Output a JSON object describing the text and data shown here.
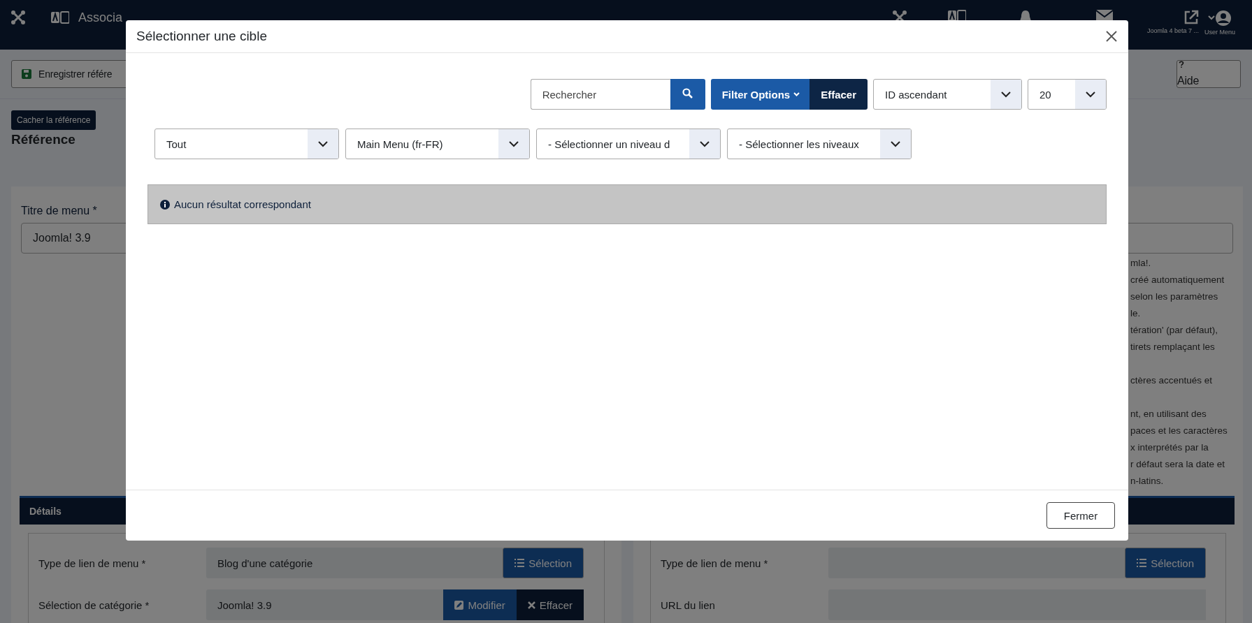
{
  "header": {
    "title": "Associa",
    "items": [
      {
        "kind": "logo"
      },
      {
        "kind": "translate"
      },
      {
        "kind": "bell"
      },
      {
        "kind": "mail"
      },
      {
        "kind": "external",
        "label": "Joomla 4 beta 7 ..."
      },
      {
        "kind": "user",
        "label": "User Menu"
      }
    ]
  },
  "toolbar": {
    "buttons": [
      {
        "kind": "save",
        "label": "Enregistrer référe"
      },
      {
        "kind": "help",
        "label": "Aide"
      }
    ]
  },
  "reference": {
    "toggle": "Cacher la référence",
    "heading": "Référence"
  },
  "left_card": {
    "label": "Titre de menu *",
    "value": "Joomla! 3.9"
  },
  "right_card": {
    "help_lines": [
      "mla!.",
      "créé automatiquement",
      "selon les paramètres",
      "le.",
      "tération' (par défaut),",
      "tirets remplaçant les",
      "ctères accentués et",
      "nt, en utilisant des",
      "paces et les caractères",
      "x interprétés par la",
      "r défaut sera la date et",
      "n-latins."
    ]
  },
  "details": {
    "title": "Détails",
    "left_rows": [
      {
        "label": "Type de lien de menu *",
        "value": "Blog d'une catégorie",
        "buttons": [
          {
            "kind": "select",
            "label": "Sélection"
          }
        ]
      },
      {
        "label": "Sélection de catégorie *",
        "value": "Joomla! 3.9",
        "buttons": [
          {
            "kind": "edit",
            "label": "Modifier"
          },
          {
            "kind": "clear",
            "label": "Effacer"
          }
        ]
      }
    ],
    "right_rows": [
      {
        "label": "Type de lien de menu *",
        "buttons": [
          {
            "kind": "select",
            "label": "Sélection"
          }
        ]
      },
      {
        "label": "URL du lien"
      }
    ]
  },
  "modal": {
    "title": "Sélectionner une cible",
    "search": {
      "placeholder": "Rechercher"
    },
    "filter_button": "Filter Options",
    "clear_button": "Effacer",
    "ordering": "ID ascendant",
    "limit": "20",
    "filters": [
      "Tout",
      "Main Menu (fr-FR)",
      "- Sélectionner un niveau d",
      "- Sélectionner les niveaux"
    ],
    "message": "Aucun résultat correspondant",
    "close_button": "Fermer"
  }
}
